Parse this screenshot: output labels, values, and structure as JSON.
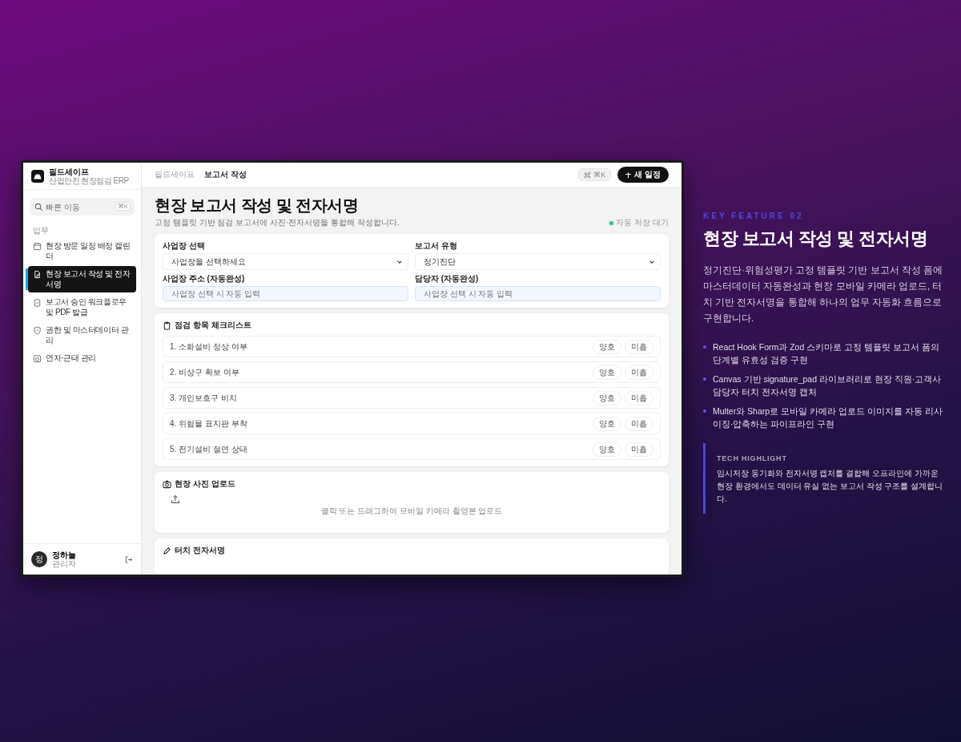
{
  "app": {
    "brand": {
      "name": "필드세이프",
      "subtitle": "산업안전 현장점검 ERP"
    },
    "sidebar": {
      "search": {
        "placeholder": "빠른 이동",
        "shortcut": "⌘K"
      },
      "section": "업무",
      "items": [
        {
          "label": "현장 방문 일정 배정 캘린더",
          "selected": false
        },
        {
          "label": "현장 보고서 작성 및 전자서명",
          "selected": true
        },
        {
          "label": "보고서 승인 워크플로우 및 PDF 발급",
          "selected": false
        },
        {
          "label": "권한 및 마스터데이터 관리",
          "selected": false
        },
        {
          "label": "연차·근태 관리",
          "selected": false
        }
      ],
      "user": {
        "avatar": "정",
        "name": "정하늘",
        "role": "관리자"
      }
    },
    "header": {
      "breadcrumbs": [
        "필드세이프",
        "보고서 작성"
      ],
      "command_shortcut": "⌘K",
      "new_button": "새 일정"
    },
    "page": {
      "title": "현장 보고서 작성 및 전자서명",
      "subtitle": "고정 템플릿 기반 점검 보고서에 사진·전자서명을 통합해 작성합니다.",
      "autosave": "자동 저장 대기"
    },
    "form": {
      "fields": [
        {
          "label": "사업장 선택",
          "kind": "select",
          "value": "사업장을 선택하세요"
        },
        {
          "label": "보고서 유형",
          "kind": "select",
          "value": "정기진단"
        },
        {
          "label": "사업장 주소 (자동완성)",
          "kind": "input",
          "placeholder": "사업장 선택 시 자동 입력"
        },
        {
          "label": "담당자 (자동완성)",
          "kind": "input",
          "placeholder": "사업장 선택 시 자동 입력"
        }
      ]
    },
    "checklist": {
      "title": "점검 항목 체크리스트",
      "items": [
        {
          "label": "1. 소화설비 정상 여부",
          "options": [
            {
              "label": "양호",
              "selected": false
            },
            {
              "label": "미흡",
              "selected": false
            }
          ]
        },
        {
          "label": "2. 비상구 확보 여부",
          "options": [
            {
              "label": "양호",
              "selected": false
            },
            {
              "label": "미흡",
              "selected": false
            }
          ]
        },
        {
          "label": "3. 개인보호구 비치",
          "options": [
            {
              "label": "양호",
              "selected": false
            },
            {
              "label": "미흡",
              "selected": false
            }
          ]
        },
        {
          "label": "4. 위험물 표지판 부착",
          "options": [
            {
              "label": "양호",
              "selected": false
            },
            {
              "label": "미흡",
              "selected": false
            }
          ]
        },
        {
          "label": "5. 전기설비 절연 상태",
          "options": [
            {
              "label": "양호",
              "selected": false
            },
            {
              "label": "미흡",
              "selected": false
            }
          ]
        }
      ]
    },
    "upload": {
      "title": "현장 사진 업로드",
      "hint": "클릭 또는 드래그하여 모바일 카메라 촬영본 업로드"
    },
    "signature": {
      "title": "터치 전자서명"
    }
  },
  "feature": {
    "eyebrow": "KEY FEATURE 02",
    "title": "현장 보고서 작성 및 전자서명",
    "description": "정기진단·위험성평가 고정 템플릿 기반 보고서 작성 폼에 마스터데이터 자동완성과 현장 모바일 카메라 업로드, 터치 기반 전자서명을 통합해 하나의 업무 자동화 흐름으로 구현합니다.",
    "bullets": [
      "React Hook Form과 Zod 스키마로 고정 템플릿 보고서 폼의 단계별 유효성 검증 구현",
      "Canvas 기반 signature_pad 라이브러리로 현장 직원·고객사 담당자 터치 전자서명 캡처",
      "Multer와 Sharp로 모바일 카메라 업로드 이미지를 자동 리사이징·압축하는 파이프라인 구현"
    ],
    "highlight": {
      "label": "TECH HIGHLIGHT",
      "text": "임시저장 동기화와 전자서명 캡처를 결합해 오프라인에 가까운 현장 환경에서도 데이터 유실 없는 보고서 작성 구조를 설계합니다."
    }
  }
}
